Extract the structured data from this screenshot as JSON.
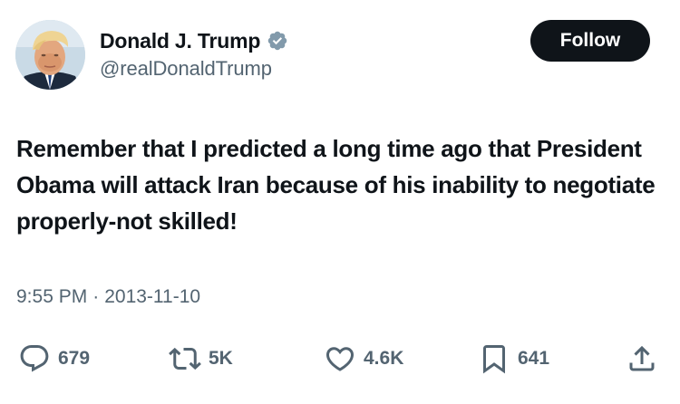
{
  "user": {
    "display_name": "Donald J. Trump",
    "handle": "@realDonaldTrump",
    "verified": true,
    "avatar_icon": "profile-photo"
  },
  "follow_button": {
    "label": "Follow"
  },
  "tweet": {
    "text": "Remember that I predicted a long time ago that President Obama will attack Iran because of his inability to negotiate properly-not skilled!",
    "time": "9:55 PM",
    "separator": "·",
    "date": "2013-11-10"
  },
  "actions": {
    "reply": {
      "icon": "reply-icon",
      "count": "679"
    },
    "retweet": {
      "icon": "retweet-icon",
      "count": "5K"
    },
    "like": {
      "icon": "heart-icon",
      "count": "4.6K"
    },
    "bookmark": {
      "icon": "bookmark-icon",
      "count": "641"
    },
    "share": {
      "icon": "share-icon"
    }
  },
  "colors": {
    "text_primary": "#0f1419",
    "text_secondary": "#536471",
    "verified_badge": "#829aab",
    "button_bg": "#0f1419",
    "button_text": "#ffffff"
  }
}
